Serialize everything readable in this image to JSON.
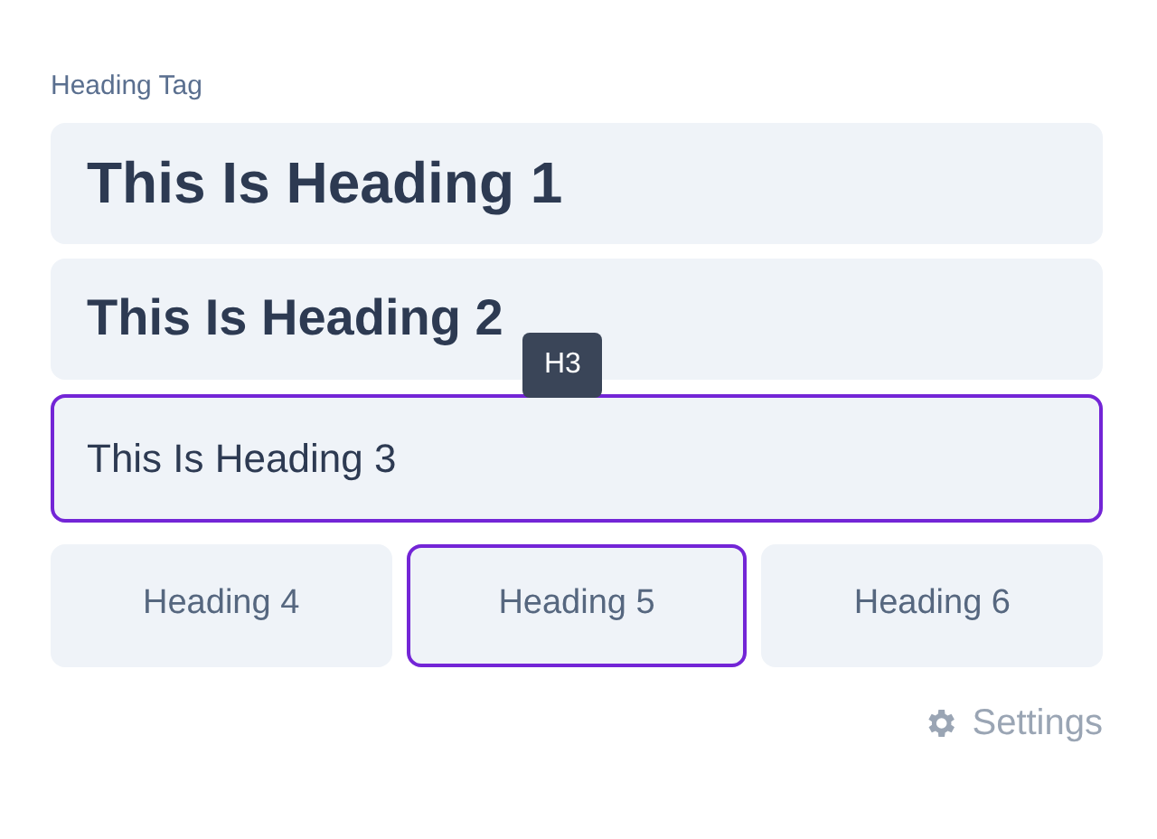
{
  "label": "Heading Tag",
  "options": [
    {
      "kind": "h1",
      "text": "This Is Heading 1",
      "selected": false
    },
    {
      "kind": "h2",
      "text": "This Is Heading 2",
      "selected": false
    },
    {
      "kind": "h3",
      "text": "This Is Heading 3",
      "selected": true
    },
    {
      "kind": "h4",
      "text": "Heading 4",
      "selected": false
    },
    {
      "kind": "h5",
      "text": "Heading 5",
      "selected": true
    },
    {
      "kind": "h6",
      "text": "Heading 6",
      "selected": false
    }
  ],
  "tooltip": {
    "text": "H3"
  },
  "settings": {
    "text": "Settings"
  }
}
